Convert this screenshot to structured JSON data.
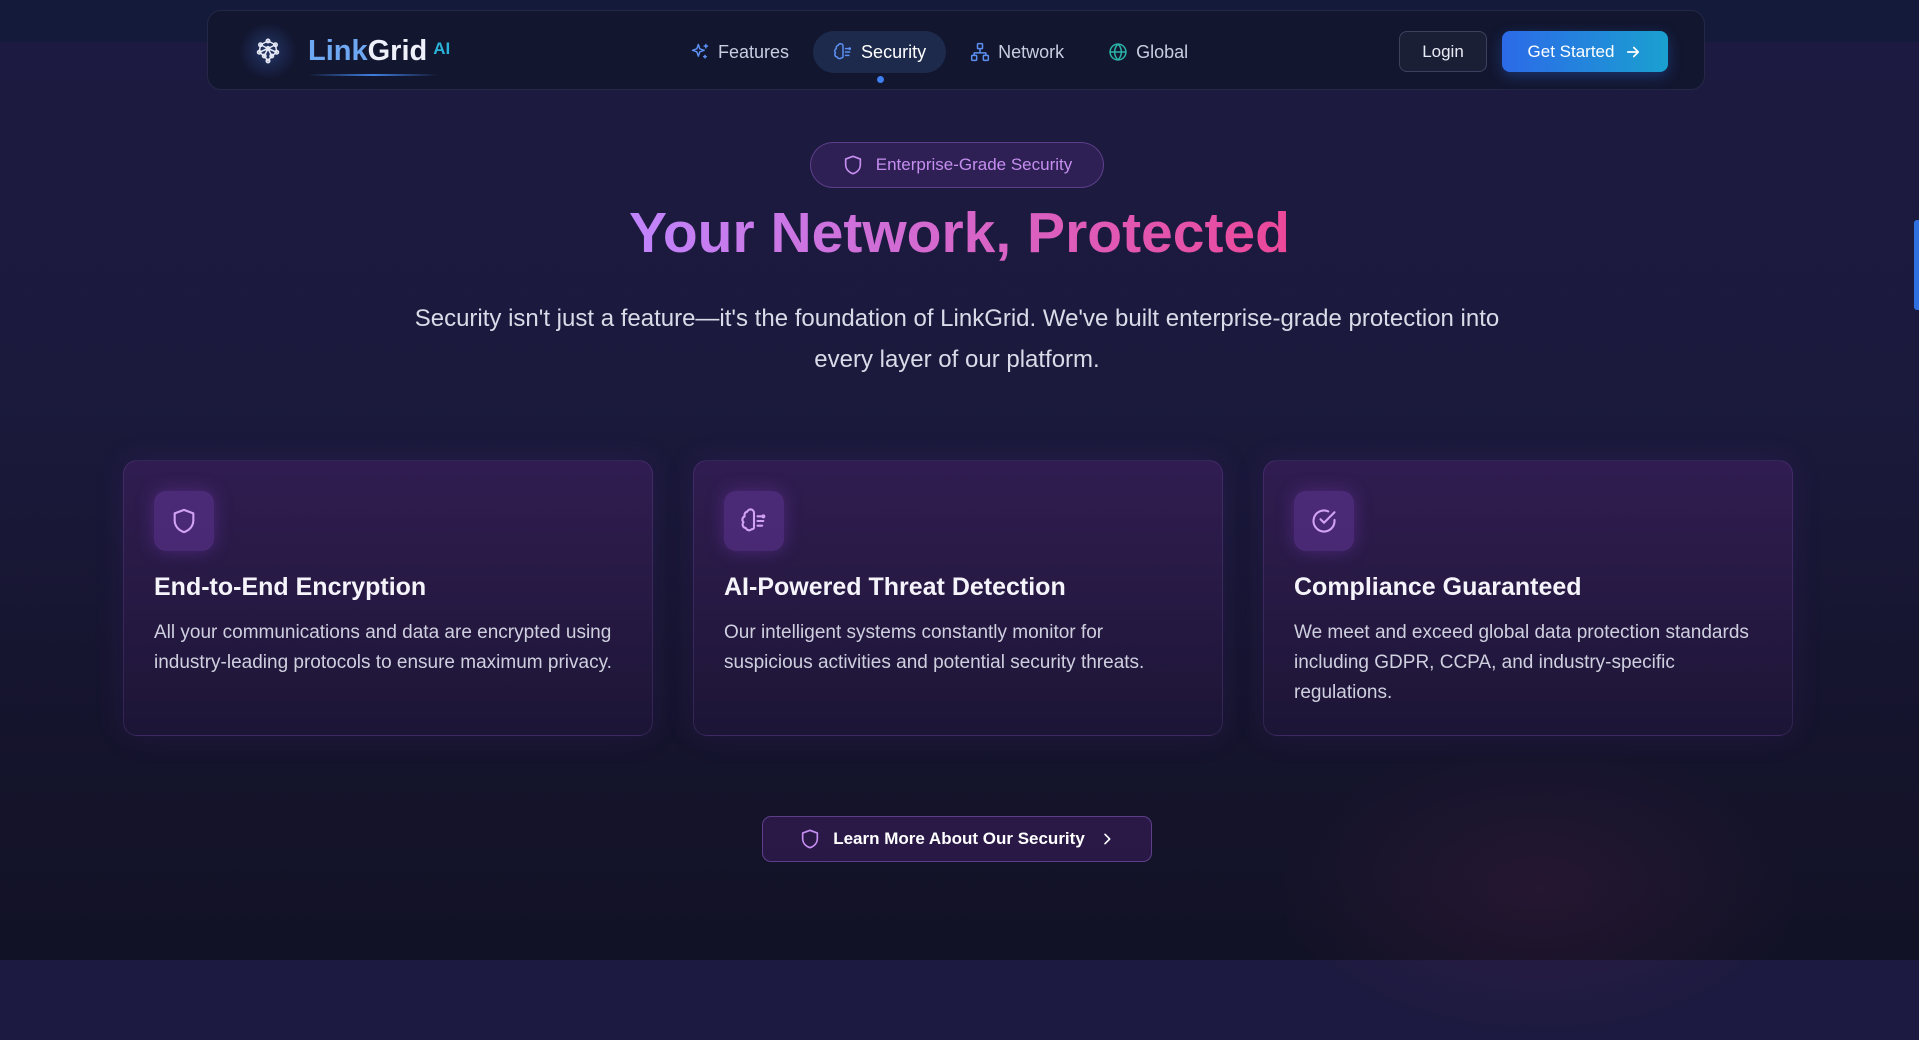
{
  "brand": {
    "name_part1": "Link",
    "name_part2": "Grid",
    "suffix": "AI"
  },
  "nav": {
    "items": [
      {
        "label": "Features",
        "icon": "sparkles-icon",
        "active": false
      },
      {
        "label": "Security",
        "icon": "brain-icon",
        "active": true
      },
      {
        "label": "Network",
        "icon": "network-icon",
        "active": false
      },
      {
        "label": "Global",
        "icon": "globe-icon",
        "active": false
      }
    ],
    "login_label": "Login",
    "cta_label": "Get Started"
  },
  "hero": {
    "badge": "Enterprise-Grade Security",
    "title": "Your Network, Protected",
    "subtitle": "Security isn't just a feature—it's the foundation of LinkGrid. We've built enterprise-grade protection into every layer of our platform."
  },
  "cards": [
    {
      "icon": "shield-icon",
      "title": "End-to-End Encryption",
      "description": "All your communications and data are encrypted using industry-leading protocols to ensure maximum privacy."
    },
    {
      "icon": "brain-icon",
      "title": "AI-Powered Threat Detection",
      "description": "Our intelligent systems constantly monitor for suspicious activities and potential security threats."
    },
    {
      "icon": "check-circle-icon",
      "title": "Compliance Guaranteed",
      "description": "We meet and exceed global data protection standards including GDPR, CCPA, and industry-specific regulations."
    }
  ],
  "cta": {
    "label": "Learn More About Our Security"
  },
  "colors": {
    "accent_blue": "#3e7ff0",
    "accent_purple": "#c58ef0",
    "title_gradient_start": "#c084fc",
    "title_gradient_end": "#ec4899"
  }
}
